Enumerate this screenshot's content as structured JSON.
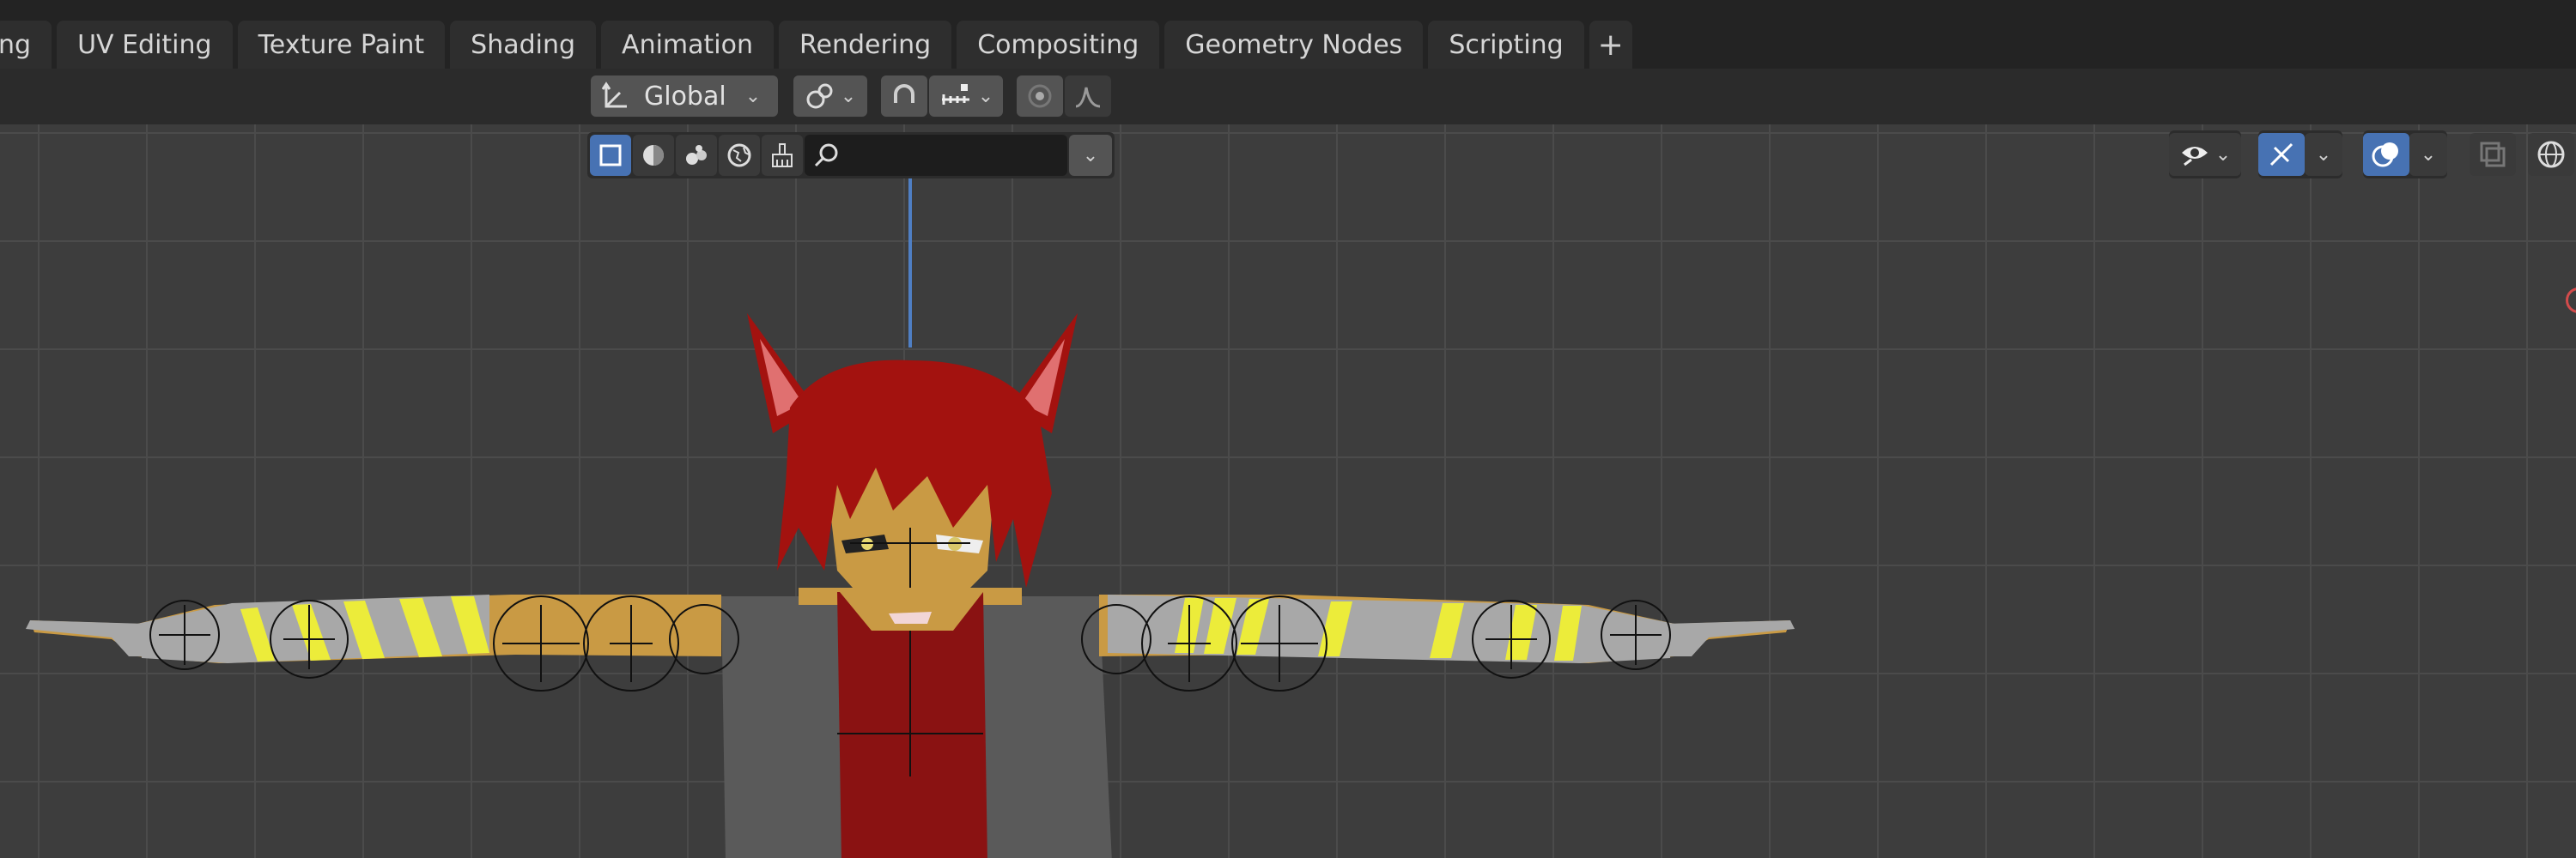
{
  "workspace_tabs": [
    {
      "label": "ng"
    },
    {
      "label": "UV Editing"
    },
    {
      "label": "Texture Paint"
    },
    {
      "label": "Shading"
    },
    {
      "label": "Animation"
    },
    {
      "label": "Rendering"
    },
    {
      "label": "Compositing"
    },
    {
      "label": "Geometry Nodes"
    },
    {
      "label": "Scripting"
    }
  ],
  "add_tab_label": "+",
  "header": {
    "transform_orientation": "Global",
    "search_value": ""
  },
  "icons": {
    "orientation": "transform-orientation-icon",
    "pivot": "pivot-point-icon",
    "snap": "snap-magnet-icon",
    "snap_target": "snap-increment-icon",
    "proportional": "proportional-edit-icon",
    "falloff": "falloff-curve-icon",
    "search": "search-icon",
    "visibility": "visibility-eye-icon",
    "gizmo": "gizmo-icon",
    "overlays": "overlays-icon",
    "xray": "xray-icon",
    "shading": "shading-wireframe-icon"
  },
  "colors": {
    "tabbar": "#232323",
    "viewport": "#3d3d3d",
    "grid": "#4b4b4b",
    "accent_blue": "#4772b3",
    "hair": "#a3120f",
    "skin": "#c99a44",
    "vest": "#5a5a5a",
    "shirt": "#8a1212",
    "stripe_yellow": "#ecec3a",
    "stripe_gray": "#a8a8a8"
  }
}
